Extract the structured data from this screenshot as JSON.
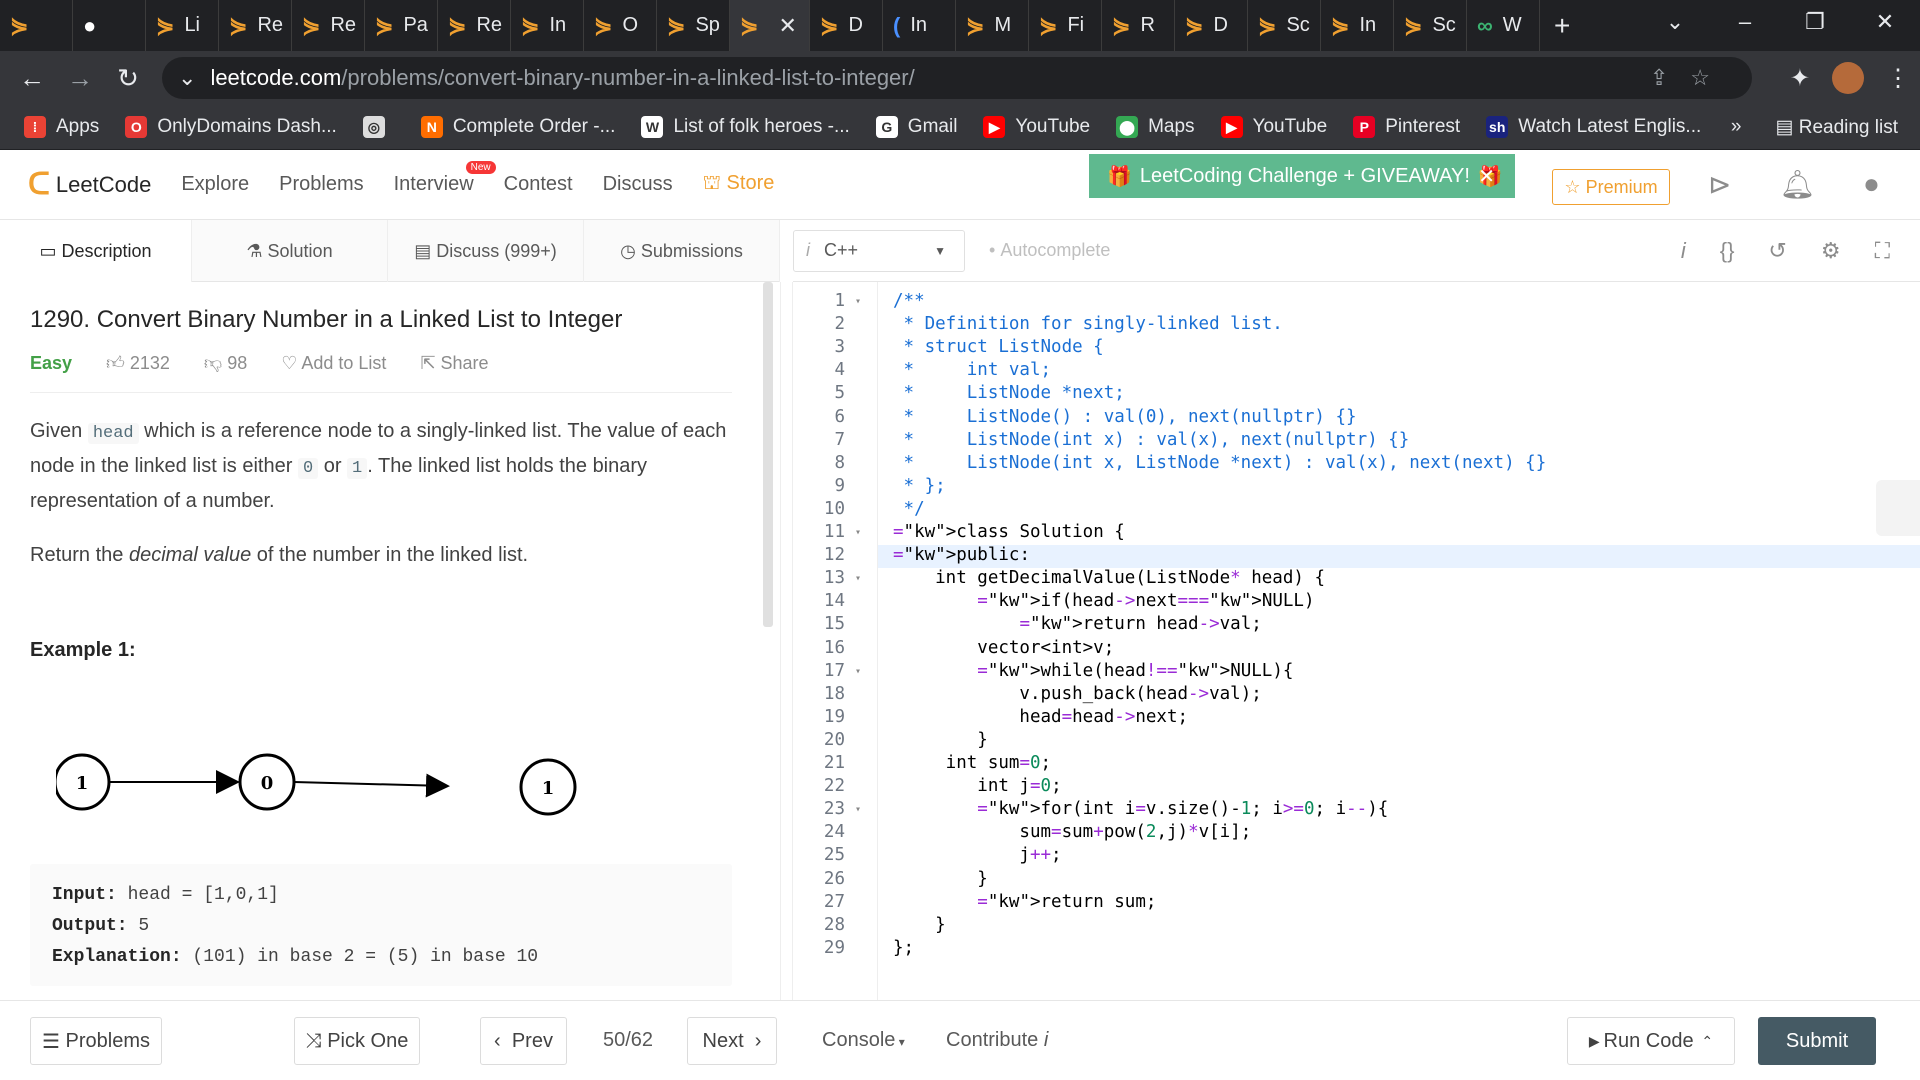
{
  "browser": {
    "tabs": [
      {
        "label": "",
        "icon": "leetcode-icon"
      },
      {
        "label": "",
        "icon": "github-icon"
      },
      {
        "label": "Li",
        "icon": "leetcode-icon"
      },
      {
        "label": "Re",
        "icon": "leetcode-icon"
      },
      {
        "label": "Re",
        "icon": "leetcode-icon"
      },
      {
        "label": "Pa",
        "icon": "leetcode-icon"
      },
      {
        "label": "Re",
        "icon": "leetcode-icon"
      },
      {
        "label": "In",
        "icon": "leetcode-icon"
      },
      {
        "label": "O",
        "icon": "leetcode-icon"
      },
      {
        "label": "Sp",
        "icon": "leetcode-icon"
      },
      {
        "label": "",
        "icon": "leetcode-icon",
        "active": true
      },
      {
        "label": "D",
        "icon": "leetcode-icon"
      },
      {
        "label": "In",
        "icon": "bracket-icon"
      },
      {
        "label": "M",
        "icon": "leetcode-icon"
      },
      {
        "label": "Fi",
        "icon": "leetcode-icon"
      },
      {
        "label": "R",
        "icon": "leetcode-icon"
      },
      {
        "label": "D",
        "icon": "leetcode-icon"
      },
      {
        "label": "Sc",
        "icon": "leetcode-icon"
      },
      {
        "label": "In",
        "icon": "leetcode-icon"
      },
      {
        "label": "Sc",
        "icon": "leetcode-icon"
      },
      {
        "label": "W",
        "icon": "glasses-icon"
      }
    ],
    "url_domain": "leetcode.com",
    "url_path": "/problems/convert-binary-number-in-a-linked-list-to-integer/",
    "bookmarks": [
      {
        "label": "Apps",
        "icon": "apps-icon",
        "color": "#ea4335"
      },
      {
        "label": "OnlyDomains Dash...",
        "icon": "onlydomains-icon",
        "color": "#e53935"
      },
      {
        "label": "",
        "icon": "globe-icon",
        "color": "#dddddd"
      },
      {
        "label": "Complete Order -...",
        "icon": "order-icon",
        "color": "#ff6d00"
      },
      {
        "label": "List of folk heroes -...",
        "icon": "wikipedia-icon",
        "color": "#ffffff"
      },
      {
        "label": "Gmail",
        "icon": "google-icon",
        "color": "#ffffff"
      },
      {
        "label": "YouTube",
        "icon": "youtube-icon",
        "color": "#ff0000"
      },
      {
        "label": "Maps",
        "icon": "maps-icon",
        "color": "#34a853"
      },
      {
        "label": "YouTube",
        "icon": "youtube-icon",
        "color": "#ff0000"
      },
      {
        "label": "Pinterest",
        "icon": "pinterest-icon",
        "color": "#e60023"
      },
      {
        "label": "Watch Latest Englis...",
        "icon": "sh-icon",
        "color": "#1a237e"
      }
    ],
    "more": "»",
    "reading_list": "Reading list"
  },
  "header": {
    "logo": "LeetCode",
    "nav": [
      "Explore",
      "Problems",
      "Interview",
      "Contest",
      "Discuss",
      "Store"
    ],
    "new_badge": "New",
    "promo": "LeetCoding Challenge + GIVEAWAY!",
    "premium": "Premium"
  },
  "subtabs": [
    "Description",
    "Solution",
    "Discuss (999+)",
    "Submissions"
  ],
  "editor_bar": {
    "info": "i",
    "language": "C++",
    "autocomplete": "Autocomplete"
  },
  "problem": {
    "title": "1290. Convert Binary Number in a Linked List to Integer",
    "difficulty": "Easy",
    "likes": "2132",
    "dislikes": "98",
    "add_to_list": "Add to List",
    "share": "Share",
    "p1": [
      "Given ",
      "head",
      " which is a reference node to a singly-linked list. The value of each node in the linked list is either ",
      "0",
      " or ",
      "1",
      ". The linked list holds the binary representation of a number."
    ],
    "p2": [
      "Return the ",
      "decimal value",
      " of the number in the linked list."
    ],
    "example_heading": "Example 1:",
    "diagram_nodes": [
      "1",
      "0",
      "1"
    ],
    "example": {
      "input_label": "Input:",
      "input_value": " head = [1,0,1]",
      "output_label": "Output:",
      "output_value": " 5",
      "expl_label": "Explanation:",
      "expl_value": " (101) in base 2 = (5) in base 10"
    }
  },
  "code": {
    "highlighted_line": 12,
    "fold_lines": [
      1,
      11,
      13,
      17,
      23
    ],
    "lines": [
      "/**",
      " * Definition for singly-linked list.",
      " * struct ListNode {",
      " *     int val;",
      " *     ListNode *next;",
      " *     ListNode() : val(0), next(nullptr) {}",
      " *     ListNode(int x) : val(x), next(nullptr) {}",
      " *     ListNode(int x, ListNode *next) : val(x), next(next) {}",
      " * };",
      " */",
      "class Solution {",
      "public:",
      "    int getDecimalValue(ListNode* head) {",
      "        if(head->next==NULL)",
      "            return head->val;",
      "        vector<int>v;",
      "        while(head!=NULL){",
      "            v.push_back(head->val);",
      "            head=head->next;",
      "        }",
      "     int sum=0;",
      "        int j=0;",
      "        for(int i=v.size()-1; i>=0; i--){",
      "            sum=sum+pow(2,j)*v[i];",
      "            j++;",
      "        }",
      "        return sum;",
      "    }",
      "};"
    ]
  },
  "footer": {
    "problems": "Problems",
    "pick_one": "Pick One",
    "prev": "Prev",
    "counter": "50/62",
    "next": "Next",
    "console": "Console",
    "contribute": "Contribute",
    "contribute_info": "i",
    "run_code": "Run Code",
    "submit": "Submit"
  },
  "colors": {
    "accent": "#f0a030",
    "easy": "#43a047",
    "submit": "#455a64",
    "promo": "#5fb98f"
  }
}
